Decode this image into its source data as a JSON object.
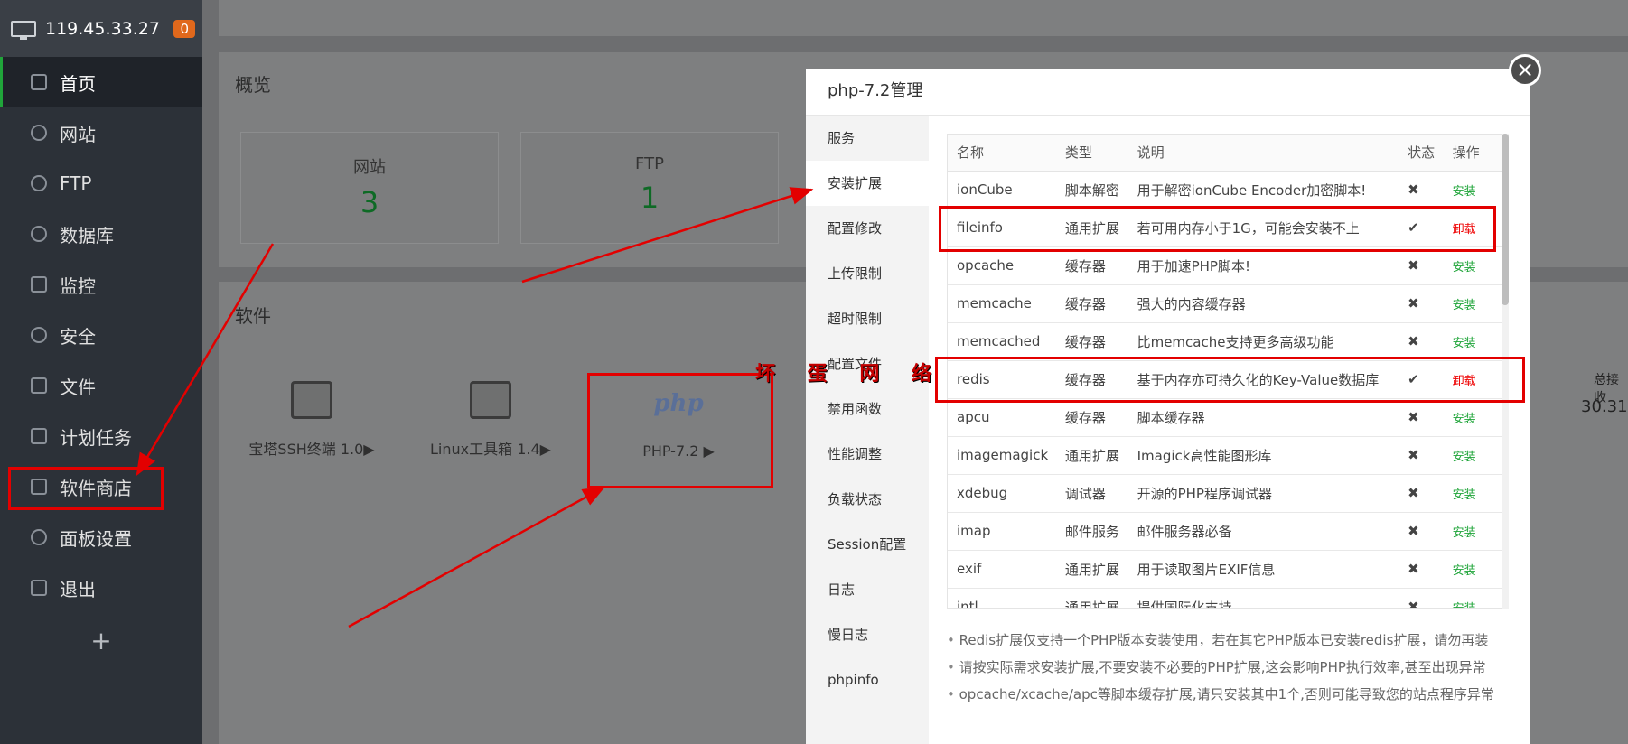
{
  "sidebar": {
    "ip": "119.45.33.27",
    "badge": "0",
    "items": [
      {
        "label": "首页",
        "icon": "home-icon"
      },
      {
        "label": "网站",
        "icon": "globe-icon"
      },
      {
        "label": "FTP",
        "icon": "ftp-icon"
      },
      {
        "label": "数据库",
        "icon": "database-icon"
      },
      {
        "label": "监控",
        "icon": "monitor-icon"
      },
      {
        "label": "安全",
        "icon": "shield-icon"
      },
      {
        "label": "文件",
        "icon": "folder-icon"
      },
      {
        "label": "计划任务",
        "icon": "calendar-icon"
      },
      {
        "label": "软件商店",
        "icon": "grid-icon"
      },
      {
        "label": "面板设置",
        "icon": "gear-icon"
      },
      {
        "label": "退出",
        "icon": "logout-icon"
      }
    ],
    "add": "+"
  },
  "overview": {
    "title": "概览",
    "stats": [
      {
        "label": "网站",
        "value": "3"
      },
      {
        "label": "FTP",
        "value": "1"
      }
    ]
  },
  "software": {
    "title": "软件",
    "items": [
      {
        "label": "宝塔SSH终端 1.0▶"
      },
      {
        "label": "Linux工具箱 1.4▶"
      },
      {
        "label": "PHP-7.2 ▶",
        "logo": "php"
      }
    ]
  },
  "right_info": {
    "label": "总接收",
    "value": "30.31"
  },
  "modal": {
    "title": "php-7.2管理",
    "close": "×",
    "nav": [
      "服务",
      "安装扩展",
      "配置修改",
      "上传限制",
      "超时限制",
      "配置文件",
      "禁用函数",
      "性能调整",
      "负载状态",
      "Session配置",
      "日志",
      "慢日志",
      "phpinfo"
    ],
    "columns": [
      "名称",
      "类型",
      "说明",
      "状态",
      "操作"
    ],
    "rows": [
      {
        "name": "ionCube",
        "type": "脚本解密",
        "desc": "用于解密ionCube Encoder加密脚本!",
        "status": "✖",
        "action": "安装"
      },
      {
        "name": "fileinfo",
        "type": "通用扩展",
        "desc": "若可用内存小于1G，可能会安装不上",
        "status": "✔",
        "action": "卸载"
      },
      {
        "name": "opcache",
        "type": "缓存器",
        "desc": "用于加速PHP脚本!",
        "status": "✖",
        "action": "安装"
      },
      {
        "name": "memcache",
        "type": "缓存器",
        "desc": "强大的内容缓存器",
        "status": "✖",
        "action": "安装"
      },
      {
        "name": "memcached",
        "type": "缓存器",
        "desc": "比memcache支持更多高级功能",
        "status": "✖",
        "action": "安装"
      },
      {
        "name": "redis",
        "type": "缓存器",
        "desc": "基于内存亦可持久化的Key-Value数据库",
        "status": "✔",
        "action": "卸载"
      },
      {
        "name": "apcu",
        "type": "缓存器",
        "desc": "脚本缓存器",
        "status": "✖",
        "action": "安装"
      },
      {
        "name": "imagemagick",
        "type": "通用扩展",
        "desc": "Imagick高性能图形库",
        "status": "✖",
        "action": "安装"
      },
      {
        "name": "xdebug",
        "type": "调试器",
        "desc": "开源的PHP程序调试器",
        "status": "✖",
        "action": "安装"
      },
      {
        "name": "imap",
        "type": "邮件服务",
        "desc": "邮件服务器必备",
        "status": "✖",
        "action": "安装"
      },
      {
        "name": "exif",
        "type": "通用扩展",
        "desc": "用于读取图片EXIF信息",
        "status": "✖",
        "action": "安装"
      },
      {
        "name": "intl",
        "type": "通用扩展",
        "desc": "提供国际化支持",
        "status": "✖",
        "action": "安装"
      }
    ],
    "tips": [
      "Redis扩展仅支持一个PHP版本安装使用，若在其它PHP版本已安装redis扩展，请勿再装",
      "请按实际需求安装扩展,不要安装不必要的PHP扩展,这会影响PHP执行效率,甚至出现异常",
      "opcache/xcache/apc等脚本缓存扩展,请只安装其中1个,否则可能导致您的站点程序异常"
    ]
  },
  "watermark": "坏 蛋 网 络",
  "colors": {
    "accent": "#20a53a",
    "danger": "#ee0000",
    "annotation": "#e30000",
    "sidebar": "#2c3138"
  }
}
